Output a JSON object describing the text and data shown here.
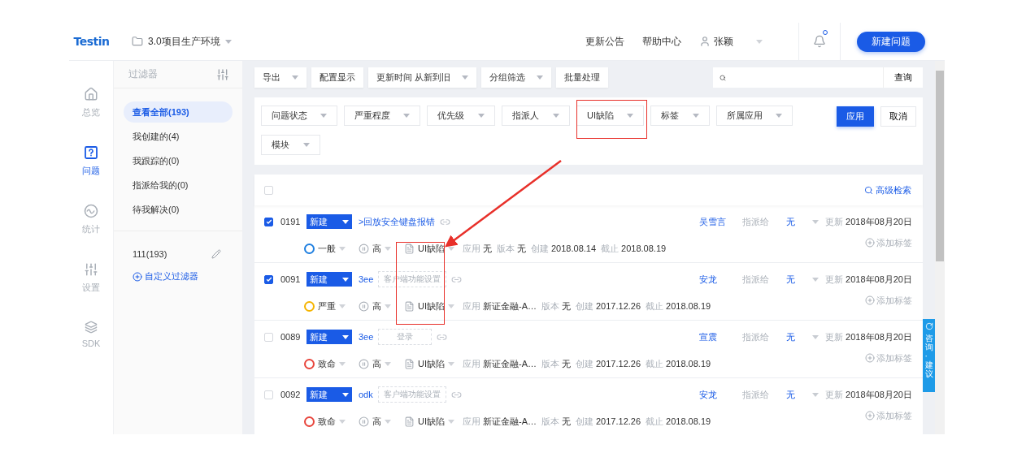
{
  "header": {
    "logo": "Testin",
    "project": "3.0项目生产环境",
    "links": [
      "更新公告",
      "帮助中心"
    ],
    "user": "张颖",
    "notification_dot": true,
    "new_button": "新建问题"
  },
  "nav": [
    {
      "label": "总览",
      "kind": "home",
      "selected": false
    },
    {
      "label": "问题",
      "kind": "issue",
      "selected": true
    },
    {
      "label": "统计",
      "kind": "stats",
      "selected": false
    },
    {
      "label": "设置",
      "kind": "settings",
      "selected": false
    },
    {
      "label": "SDK",
      "kind": "sdk",
      "selected": false
    }
  ],
  "filter_sidebar": {
    "title": "过滤器",
    "items": [
      {
        "label": "查看全部(193)",
        "selected": true
      },
      {
        "label": "我创建的(4)",
        "selected": false
      },
      {
        "label": "我跟踪的(0)",
        "selected": false
      },
      {
        "label": "指派给我的(0)",
        "selected": false
      },
      {
        "label": "待我解决(0)",
        "selected": false
      }
    ],
    "saved": [
      {
        "label": "111(193)"
      }
    ],
    "add_link": "自定义过滤器"
  },
  "toolbar": {
    "buttons": [
      {
        "label": "导出",
        "dropdown": true
      },
      {
        "label": "配置显示",
        "dropdown": false
      },
      {
        "label": "更新时间 从新到旧",
        "dropdown": true
      },
      {
        "label": "分组筛选",
        "dropdown": true
      },
      {
        "label": "批量处理",
        "dropdown": false
      }
    ],
    "search_button": "查询"
  },
  "filters": {
    "dropdowns": [
      "问题状态",
      "严重程度",
      "优先级",
      "指派人",
      "UI缺陷",
      "标签",
      "所属应用",
      "模块"
    ],
    "apply": "应用",
    "cancel": "取消"
  },
  "list": {
    "select_all_checked": false,
    "advanced_search": "高级检索",
    "rows": [
      {
        "checked": true,
        "id": "0191",
        "status": "新建",
        "title": ">回放安全键盘报错",
        "module": null,
        "assignee": "吴雪言",
        "assign_label": "指派给",
        "assign_value": "无",
        "update_label": "更新",
        "updated": "2018年08月20日",
        "severity": "一般",
        "color": "#1e7fe0",
        "priority": "高",
        "defect_type": "UI缺陷",
        "app_label": "应用",
        "app": "无",
        "version_label": "版本",
        "version": "无",
        "created_label": "创建",
        "created": "2018.08.14",
        "due_label": "截止",
        "due": "2018.08.19",
        "add_tag": "添加标签"
      },
      {
        "checked": true,
        "id": "0091",
        "status": "新建",
        "title": "3ee",
        "module": "客户端功能设置",
        "assignee": "安龙",
        "assign_label": "指派给",
        "assign_value": "无",
        "update_label": "更新",
        "updated": "2018年08月20日",
        "severity": "严重",
        "color": "#f5b400",
        "priority": "高",
        "defect_type": "UI缺陷",
        "app_label": "应用",
        "app": "新证金融-A…",
        "version_label": "版本",
        "version": "无",
        "created_label": "创建",
        "created": "2017.12.26",
        "due_label": "截止",
        "due": "2018.08.19",
        "add_tag": "添加标签"
      },
      {
        "checked": false,
        "id": "0089",
        "status": "新建",
        "title": "3ee",
        "module": "登录",
        "assignee": "宣震",
        "assign_label": "指派给",
        "assign_value": "无",
        "update_label": "更新",
        "updated": "2018年08月20日",
        "severity": "致命",
        "color": "#e8453c",
        "priority": "高",
        "defect_type": "UI缺陷",
        "app_label": "应用",
        "app": "新证金融-A…",
        "version_label": "版本",
        "version": "无",
        "created_label": "创建",
        "created": "2017.12.26",
        "due_label": "截止",
        "due": "2018.08.19",
        "add_tag": "添加标签"
      },
      {
        "checked": false,
        "id": "0092",
        "status": "新建",
        "title": "odk",
        "module": "客户端功能设置",
        "assignee": "安龙",
        "assign_label": "指派给",
        "assign_value": "无",
        "update_label": "更新",
        "updated": "2018年08月20日",
        "severity": "致命",
        "color": "#e8453c",
        "priority": "高",
        "defect_type": "UI缺陷",
        "app_label": "应用",
        "app": "新证金融-A…",
        "version_label": "版本",
        "version": "无",
        "created_label": "创建",
        "created": "2017.12.26",
        "due_label": "截止",
        "due": "2018.08.19",
        "add_tag": "添加标签"
      }
    ]
  },
  "feedback_tab": "咨询·建议"
}
